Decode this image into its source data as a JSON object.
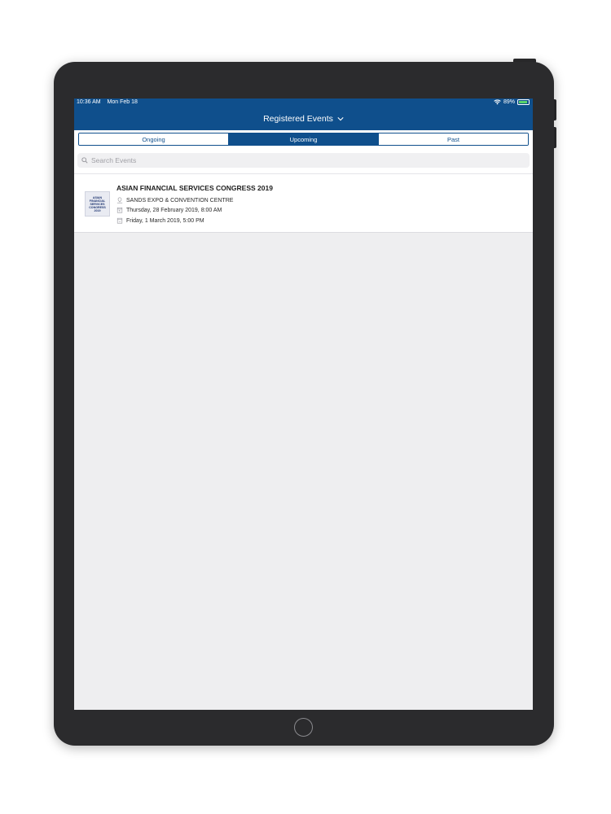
{
  "status_bar": {
    "time": "10:36 AM",
    "date": "Mon Feb 18",
    "battery_text": "89%",
    "battery_level": 0.89
  },
  "nav": {
    "title": "Registered Events"
  },
  "tabs": [
    {
      "label": "Ongoing",
      "active": false
    },
    {
      "label": "Upcoming",
      "active": true
    },
    {
      "label": "Past",
      "active": false
    }
  ],
  "search": {
    "placeholder": "Search Events",
    "value": ""
  },
  "events": [
    {
      "thumb_text": "ASIAN\nFINANCIAL\nSERVICES\nCONGRESS\n2019",
      "title": "ASIAN FINANCIAL SERVICES CONGRESS 2019",
      "venue": "SANDS EXPO & CONVENTION CENTRE",
      "start": "Thursday, 28 February 2019, 8:00 AM",
      "end": "Friday, 1 March 2019, 5:00 PM"
    }
  ],
  "colors": {
    "brand": "#0f4f8c",
    "background": "#eeeef0",
    "battery": "#58d36a"
  }
}
